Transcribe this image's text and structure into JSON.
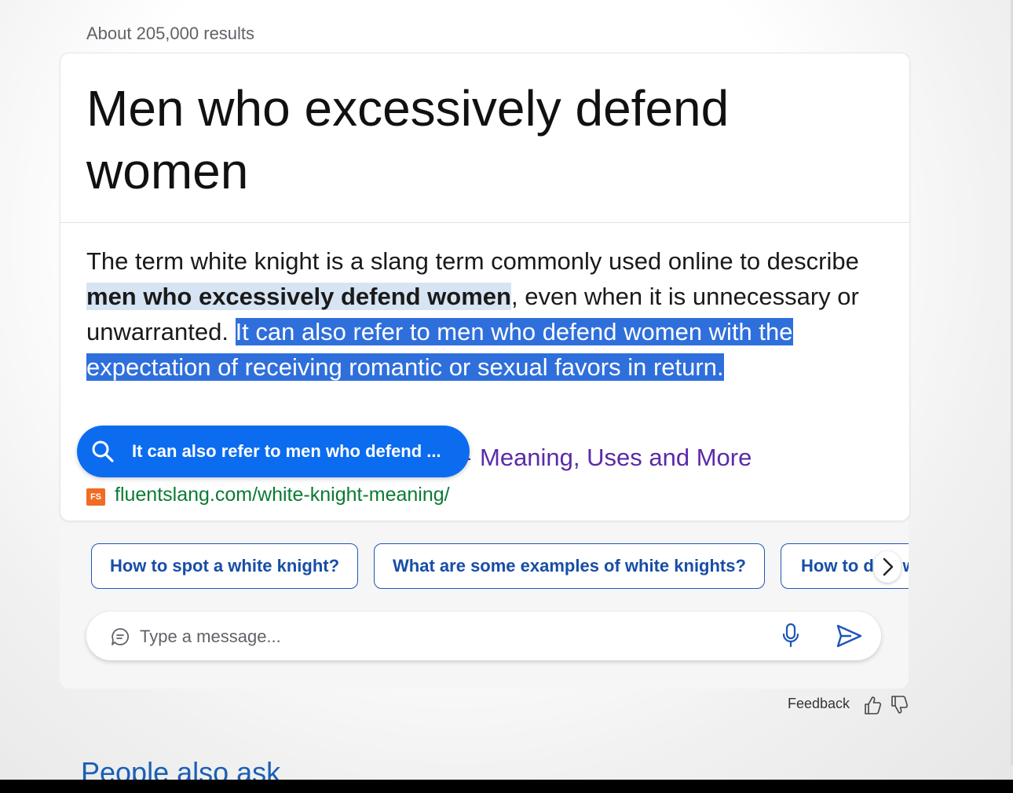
{
  "results_count": "About 205,000 results",
  "card": {
    "title": "Men who excessively defend women",
    "answer": {
      "part1": "The term white knight is a slang term commonly used online to describe ",
      "bold": "men who excessively defend women",
      "part2": ", even when it is unnecessary or unwarranted. ",
      "selected": "It can also refer to men who defend women with the expectation of receiving romantic or sexual favors in return."
    },
    "source_title_dash": "-",
    "source_title": "Meaning, Uses and More",
    "favicon_label": "FS",
    "source_url": "fluentslang.com/white-knight-meaning/"
  },
  "search_pill": {
    "label": "It can also refer to men who defend ...",
    "icon": "search-icon"
  },
  "chips": [
    {
      "label": "How to spot a white knight?"
    },
    {
      "label": "What are some examples of white knights?"
    },
    {
      "label": "How to deal with white knights?"
    }
  ],
  "message": {
    "placeholder": "Type a message..."
  },
  "feedback_label": "Feedback",
  "people_also_ask": "People also ask",
  "colors": {
    "accent_blue": "#0b6cf0",
    "selection": "#2f6fdc",
    "link_purple": "#5b2aa8",
    "url_green": "#0b7a33",
    "chip_text": "#174ea6"
  }
}
